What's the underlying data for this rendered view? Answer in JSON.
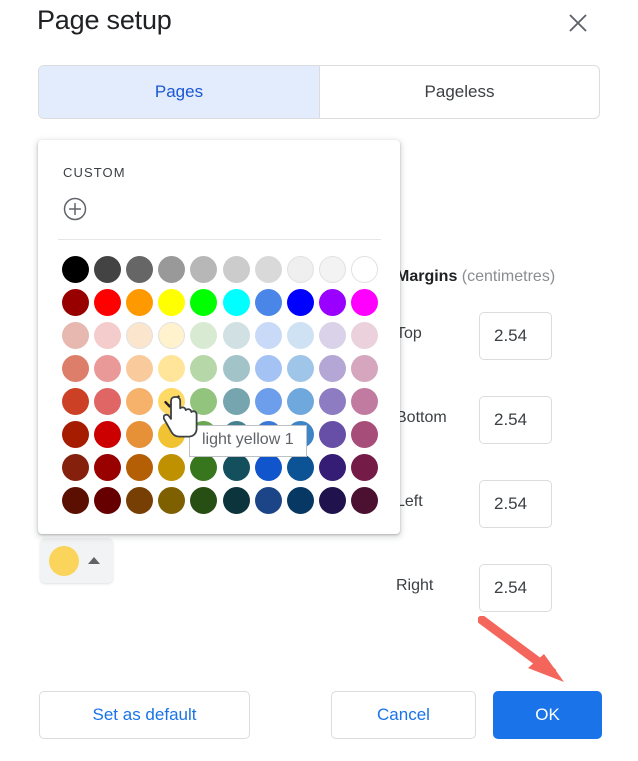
{
  "dialog": {
    "title": "Page setup",
    "close_icon": "close-icon"
  },
  "tabs": [
    {
      "label": "Pages",
      "selected": true
    },
    {
      "label": "Pageless",
      "selected": false
    }
  ],
  "margins": {
    "heading_main": "Margins",
    "heading_unit": "(centimetres)",
    "fields": [
      {
        "label": "Top",
        "value": "2.54"
      },
      {
        "label": "Bottom",
        "value": "2.54"
      },
      {
        "label": "Left",
        "value": "2.54"
      },
      {
        "label": "Right",
        "value": "2.54"
      }
    ]
  },
  "color_trigger": {
    "name": "page-colour-swatch-button",
    "swatch_color": "#fbd45c",
    "caret_icon": "caret-up-icon",
    "expanded": true
  },
  "color_picker": {
    "heading": "CUSTOM",
    "add_icon": "plus-circle-icon",
    "selected_swatch": {
      "row": 4,
      "col": 3,
      "color": "#ffd966",
      "check_icon": "check-icon"
    },
    "tooltip": "light yellow 1",
    "rows": [
      [
        "#000000",
        "#434343",
        "#666666",
        "#999999",
        "#b7b7b7",
        "#cccccc",
        "#d9d9d9",
        "#efefef",
        "#f3f3f3",
        "#ffffff"
      ],
      [
        "#980000",
        "#ff0000",
        "#ff9900",
        "#ffff00",
        "#00ff00",
        "#00ffff",
        "#4a86e8",
        "#0000ff",
        "#9900ff",
        "#ff00ff"
      ],
      [
        "#e6b8af",
        "#f4cccc",
        "#fce5cd",
        "#fff2cc",
        "#d9ead3",
        "#d0e0e3",
        "#c9daf8",
        "#cfe2f3",
        "#d9d2e9",
        "#ead1dc"
      ],
      [
        "#dd7e6b",
        "#ea9999",
        "#f9cb9c",
        "#ffe599",
        "#b6d7a8",
        "#a2c4c9",
        "#a4c2f4",
        "#9fc5e8",
        "#b4a7d6",
        "#d5a6bd"
      ],
      [
        "#cc4125",
        "#e06666",
        "#f6b26b",
        "#ffd966",
        "#93c47d",
        "#76a5af",
        "#6d9eeb",
        "#6fa8dc",
        "#8e7cc3",
        "#c27ba0"
      ],
      [
        "#a61c00",
        "#cc0000",
        "#e69138",
        "#f1c232",
        "#6aa84f",
        "#45818e",
        "#3c78d8",
        "#3d85c6",
        "#674ea7",
        "#a64d79"
      ],
      [
        "#85200c",
        "#990000",
        "#b45f06",
        "#bf9000",
        "#38761d",
        "#134f5c",
        "#1155cc",
        "#0b5394",
        "#351c75",
        "#741b47"
      ],
      [
        "#5b0f00",
        "#660000",
        "#783f04",
        "#7f6000",
        "#274e13",
        "#0c343d",
        "#1c4587",
        "#073763",
        "#20124d",
        "#4c1130"
      ]
    ]
  },
  "footer": {
    "set_default_label": "Set as default",
    "cancel_label": "Cancel",
    "ok_label": "OK"
  },
  "annotation": {
    "arrow_icon": "red-arrow-pointing-to-ok",
    "arrow_color": "#f4665b"
  },
  "cursor": {
    "icon": "hand-pointer-cursor"
  }
}
